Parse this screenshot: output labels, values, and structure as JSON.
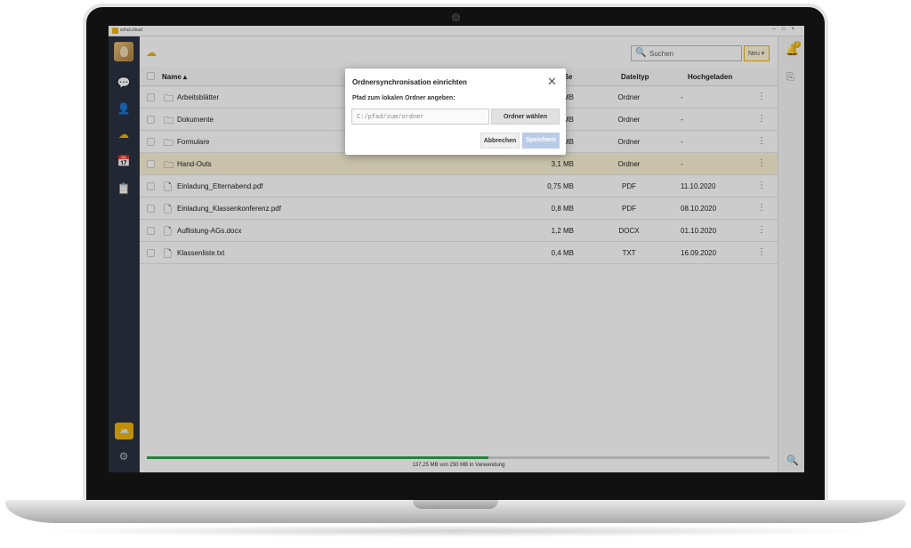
{
  "app": {
    "name": "schul.cloud",
    "window_controls": "–□×"
  },
  "sidebar": {
    "icons": [
      "chat-icon",
      "contacts-icon",
      "cloud-icon",
      "calendar-icon",
      "tasks-icon",
      "folder-sync-icon",
      "settings-icon"
    ],
    "icon_glyphs": {
      "chat": "💬",
      "contacts": "👤",
      "cloud": "☁",
      "calendar": "📅",
      "tasks": "📋",
      "sync": "⛅",
      "settings": "⚙"
    }
  },
  "topbar": {
    "search_placeholder": "Suchen",
    "new_button": "Neu ▾"
  },
  "table": {
    "columns": {
      "name": "Name ▴",
      "size": "ße",
      "type": "Dateityp",
      "uploaded": "Hochgeladen"
    },
    "rows": [
      {
        "name": "Arbeitsblätter",
        "size": "MB",
        "type": "Ordner",
        "date": "-",
        "kind": "folder"
      },
      {
        "name": "Dokumente",
        "size": "MB",
        "type": "Ordner",
        "date": "-",
        "kind": "folder"
      },
      {
        "name": "Formulare",
        "size": "MB",
        "type": "Ordner",
        "date": "-",
        "kind": "folder"
      },
      {
        "name": "Hand-Outs",
        "size": "3,1 MB",
        "type": "Ordner",
        "date": "-",
        "kind": "folder"
      },
      {
        "name": "Einladung_Elternabend.pdf",
        "size": "0,75 MB",
        "type": "PDF",
        "date": "11.10.2020",
        "kind": "file"
      },
      {
        "name": "Einladung_Klassenkonferenz.pdf",
        "size": "0,8 MB",
        "type": "PDF",
        "date": "08.10.2020",
        "kind": "file"
      },
      {
        "name": "Auflistung-AGs.docx",
        "size": "1,2 MB",
        "type": "DOCX",
        "date": "01.10.2020",
        "kind": "file"
      },
      {
        "name": "Klassenliste.txt",
        "size": "0,4 MB",
        "type": "TXT",
        "date": "16.09.2020",
        "kind": "file"
      }
    ]
  },
  "storage": {
    "text": "137,25 MB von 250 MB in Verwendung",
    "fraction": 0.549
  },
  "notifications": {
    "badge": "3"
  },
  "dialog": {
    "title": "Ordnersynchronisation einrichten",
    "label": "Pfad zum lokalen Ordner angeben:",
    "input_placeholder": "C:/pfad/zum/ordner",
    "choose_button": "Ordner wählen",
    "cancel_button": "Abbrechen",
    "save_button": "Speichern"
  },
  "colors": {
    "accent": "#f0b400",
    "sidebar": "#2a3140",
    "progress": "#2fa34f",
    "highlight_row": "#fbf3d5",
    "save_disabled": "#b9cbe6"
  }
}
